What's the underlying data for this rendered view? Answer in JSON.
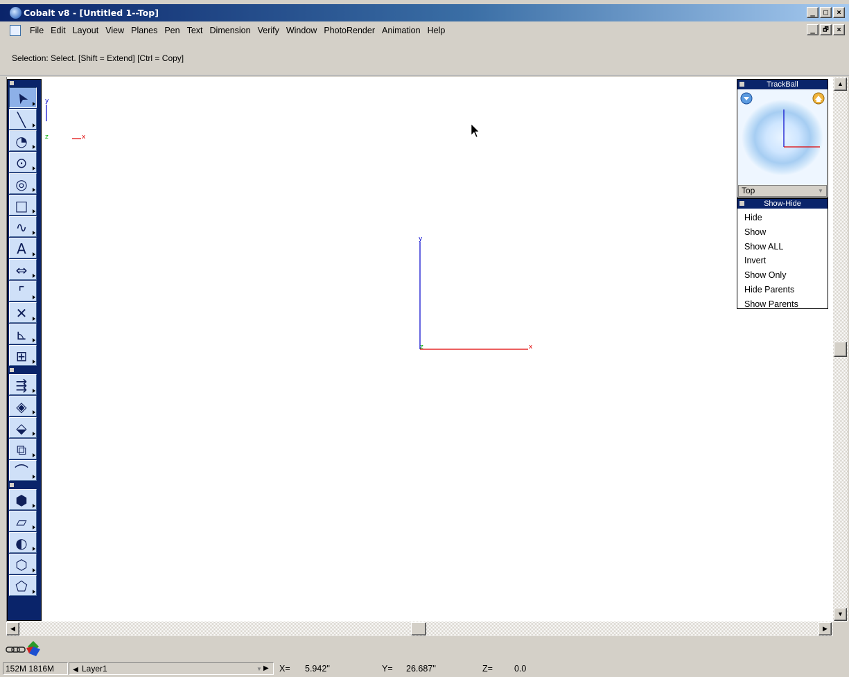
{
  "window": {
    "title": "Cobalt v8 - [Untitled 1--Top]",
    "minimize_glyph": "_",
    "maximize_glyph": "□",
    "close_glyph": "×",
    "restore_glyph": "🗗"
  },
  "menu": {
    "items": [
      "File",
      "Edit",
      "Layout",
      "View",
      "Planes",
      "Pen",
      "Text",
      "Dimension",
      "Verify",
      "Window",
      "PhotoRender",
      "Animation",
      "Help"
    ]
  },
  "prompt": {
    "text": "Selection: Select. [Shift = Extend] [Ctrl = Copy]"
  },
  "viewport": {
    "triad_small": {
      "y": "y",
      "z": "z",
      "x": "x"
    },
    "origin_axes": {
      "y": "y",
      "z": "z",
      "x": "x"
    },
    "colors": {
      "x_axis": "#e00000",
      "y_axis": "#0000cc",
      "z_axis": "#00b000"
    }
  },
  "trackball": {
    "title": "TrackBall",
    "view_selected": "Top"
  },
  "showhide": {
    "title": "Show-Hide",
    "items": [
      "Hide",
      "Show",
      "Show ALL",
      "Invert",
      "Show Only",
      "Hide Parents",
      "Show Parents"
    ]
  },
  "toolbox": {
    "group1": [
      "select-tool-icon",
      "line-tool-icon",
      "arc-tool-icon",
      "circle-tool-icon",
      "ellipse-tool-icon",
      "rectangle-tool-icon",
      "curve-tool-icon",
      "text-tool-icon",
      "dimension-tool-icon",
      "fillet-tool-icon",
      "trim-tool-icon",
      "axis-tool-icon",
      "snap-tool-icon"
    ],
    "group2": [
      "extrude-tool-icon",
      "surface-tool-icon",
      "plane-tool-icon",
      "loft-tool-icon",
      "sweep-tool-icon"
    ],
    "group3": [
      "solid-box-tool-icon",
      "solid-extrude-tool-icon",
      "solid-sweep-tool-icon",
      "solid-shell-tool-icon",
      "solid-blend-tool-icon"
    ]
  },
  "status": {
    "memory": "152M 1816M",
    "layer": "Layer1",
    "x_label": "X=",
    "x_value": "5.942''",
    "y_label": "Y=",
    "y_value": "26.687''",
    "z_label": "Z=",
    "z_value": "0.0"
  }
}
